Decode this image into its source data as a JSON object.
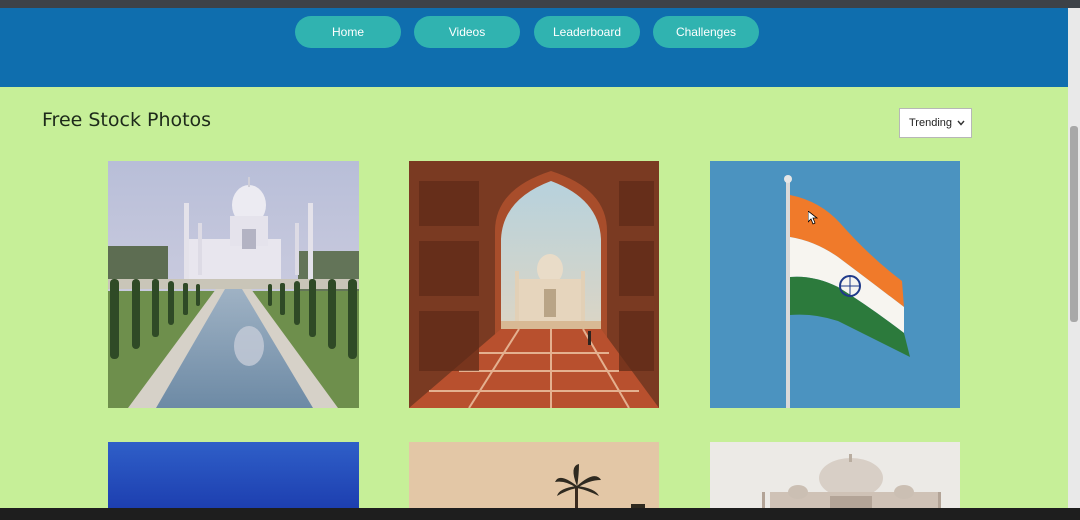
{
  "nav": {
    "items": [
      {
        "label": "Home"
      },
      {
        "label": "Videos"
      },
      {
        "label": "Leaderboard"
      },
      {
        "label": "Challenges"
      }
    ]
  },
  "page": {
    "title": "Free Stock Photos"
  },
  "sort": {
    "selected": "Trending"
  },
  "colors": {
    "page_background": "#c6ef98",
    "header_background": "#0f6eae",
    "nav_button": "#30b3b0"
  },
  "photos": [
    {
      "subject": "taj-mahal-reflecting-pool"
    },
    {
      "subject": "taj-mahal-through-arch"
    },
    {
      "subject": "indian-flag"
    },
    {
      "subject": "blue-sky"
    },
    {
      "subject": "palm-tree"
    },
    {
      "subject": "taj-mahal-domes"
    }
  ]
}
